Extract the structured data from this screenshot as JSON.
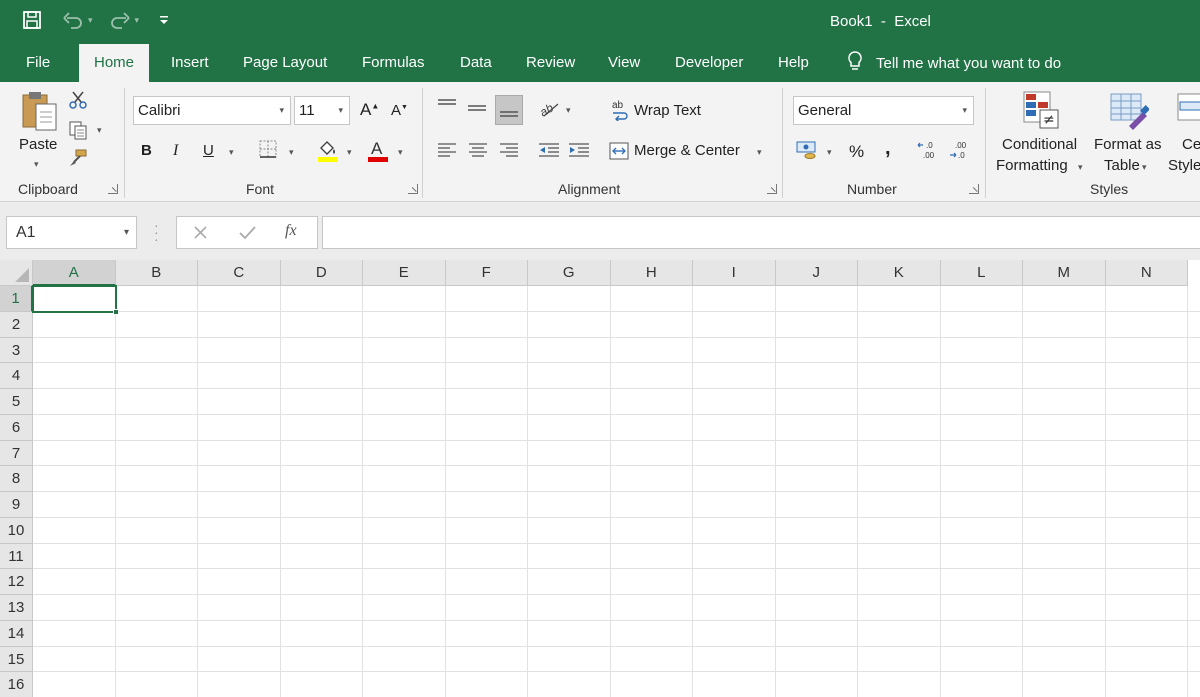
{
  "window": {
    "title": "Book1  -  Excel"
  },
  "tabs": [
    {
      "label": "File"
    },
    {
      "label": "Home"
    },
    {
      "label": "Insert"
    },
    {
      "label": "Page Layout"
    },
    {
      "label": "Formulas"
    },
    {
      "label": "Data"
    },
    {
      "label": "Review"
    },
    {
      "label": "View"
    },
    {
      "label": "Developer"
    },
    {
      "label": "Help"
    }
  ],
  "tell_me": "Tell me what you want to do",
  "ribbon": {
    "clipboard": {
      "paste": "Paste",
      "label": "Clipboard"
    },
    "font": {
      "name": "Calibri",
      "size": "11",
      "bold": "B",
      "italic": "I",
      "underline": "U",
      "label": "Font"
    },
    "alignment": {
      "wrap_text": "Wrap Text",
      "merge_center": "Merge & Center",
      "label": "Alignment"
    },
    "number": {
      "format": "General",
      "percent": "%",
      "comma": ",",
      "label": "Number"
    },
    "styles": {
      "conditional_1": "Conditional",
      "conditional_2": "Formatting",
      "format_table_1": "Format as",
      "format_table_2": "Table",
      "cell_styles_1": "Cell",
      "cell_styles_2": "Styles",
      "label": "Styles"
    }
  },
  "formula_bar": {
    "name_box": "A1",
    "fx": "fx",
    "content": ""
  },
  "grid": {
    "columns": [
      "A",
      "B",
      "C",
      "D",
      "E",
      "F",
      "G",
      "H",
      "I",
      "J",
      "K",
      "L",
      "M",
      "N"
    ],
    "rows": [
      "1",
      "2",
      "3",
      "4",
      "5",
      "6",
      "7",
      "8",
      "9",
      "10",
      "11",
      "12",
      "13",
      "14",
      "15",
      "16"
    ],
    "active_cell": "A1"
  },
  "colors": {
    "accent": "#217346",
    "ribbon_bg": "#f3f3f3"
  }
}
